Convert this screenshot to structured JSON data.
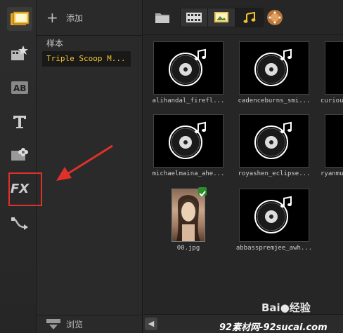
{
  "sidebar": {
    "add_label": "添加",
    "items": [
      {
        "label": "样本"
      },
      {
        "label": "Triple Scoop M..."
      }
    ],
    "browse_label": "浏览"
  },
  "rail": {
    "buttons": [
      "media-icon",
      "instant-project-icon",
      "transition-icon",
      "title-icon",
      "graphic-icon",
      "fx-icon",
      "path-icon"
    ],
    "fx_label": "FX"
  },
  "grid": {
    "tiles": [
      {
        "label": "alihandal_firefl...",
        "kind": "audio"
      },
      {
        "label": "cadenceburns_smi...",
        "kind": "audio"
      },
      {
        "label": "curiou",
        "kind": "audio"
      },
      {
        "label": "michaelmaina_ahe...",
        "kind": "audio"
      },
      {
        "label": "royashen_eclipse...",
        "kind": "audio"
      },
      {
        "label": "ryanmu",
        "kind": "audio"
      },
      {
        "label": "00.jpg",
        "kind": "photo"
      },
      {
        "label": "abbasspremjee_awh...",
        "kind": "audio"
      }
    ]
  },
  "colors": {
    "selected_text": "#f2c230",
    "annotation": "#e0302a"
  },
  "watermark": {
    "brand": "Bai",
    "brand_suffix": "经验",
    "site": "92素材网-92sucai.com"
  }
}
